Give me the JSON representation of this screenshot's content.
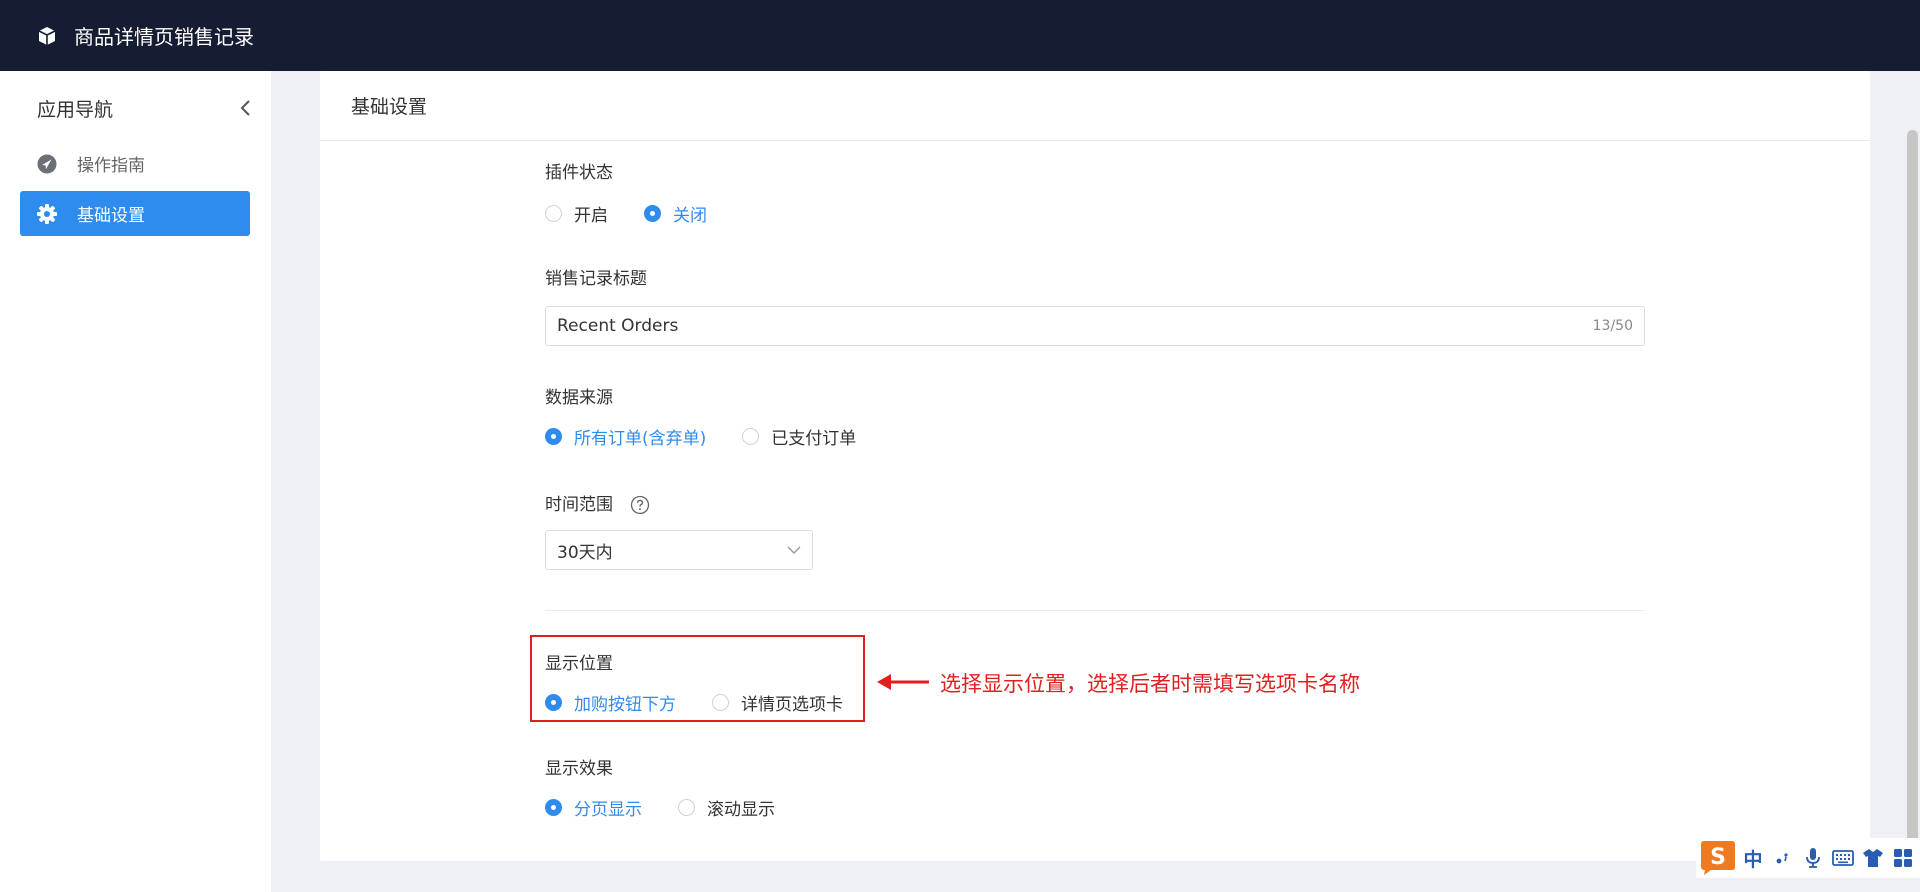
{
  "app": {
    "title": "商品详情页销售记录",
    "logo_icon": "box-icon"
  },
  "sidebar": {
    "heading": "应用导航",
    "collapse_icon": "chevron-left-icon",
    "items": [
      {
        "label": "操作指南",
        "icon": "navigation-icon",
        "active": false
      },
      {
        "label": "基础设置",
        "icon": "gear-icon",
        "active": true
      }
    ]
  },
  "card": {
    "title": "基础设置"
  },
  "form": {
    "plugin_status": {
      "label": "插件状态",
      "options": [
        "开启",
        "关闭"
      ],
      "selected": "关闭"
    },
    "sales_title": {
      "label": "销售记录标题",
      "value": "Recent Orders",
      "counter": "13/50"
    },
    "data_source": {
      "label": "数据来源",
      "options": [
        "所有订单(含弃单)",
        "已支付订单"
      ],
      "selected": "所有订单(含弃单)"
    },
    "time_range": {
      "label": "时间范围",
      "value": "30天内",
      "help_icon": "question-circle-icon"
    },
    "display_position": {
      "label": "显示位置",
      "options": [
        "加购按钮下方",
        "详情页选项卡"
      ],
      "selected": "加购按钮下方"
    },
    "display_effect": {
      "label": "显示效果",
      "options": [
        "分页显示",
        "滚动显示"
      ],
      "selected": "分页显示"
    }
  },
  "annotation": {
    "text": "选择显示位置，选择后者时需填写选项卡名称",
    "color": "#e02020"
  },
  "ime_toolbar": {
    "mode_label": "中",
    "icons": [
      "sogou-logo-icon",
      "punctuation-icon",
      "microphone-icon",
      "keyboard-icon",
      "skin-icon",
      "toolbox-icon"
    ]
  },
  "colors": {
    "topbar": "#161d33",
    "accent": "#2f8cef",
    "background": "#eef0f4"
  }
}
